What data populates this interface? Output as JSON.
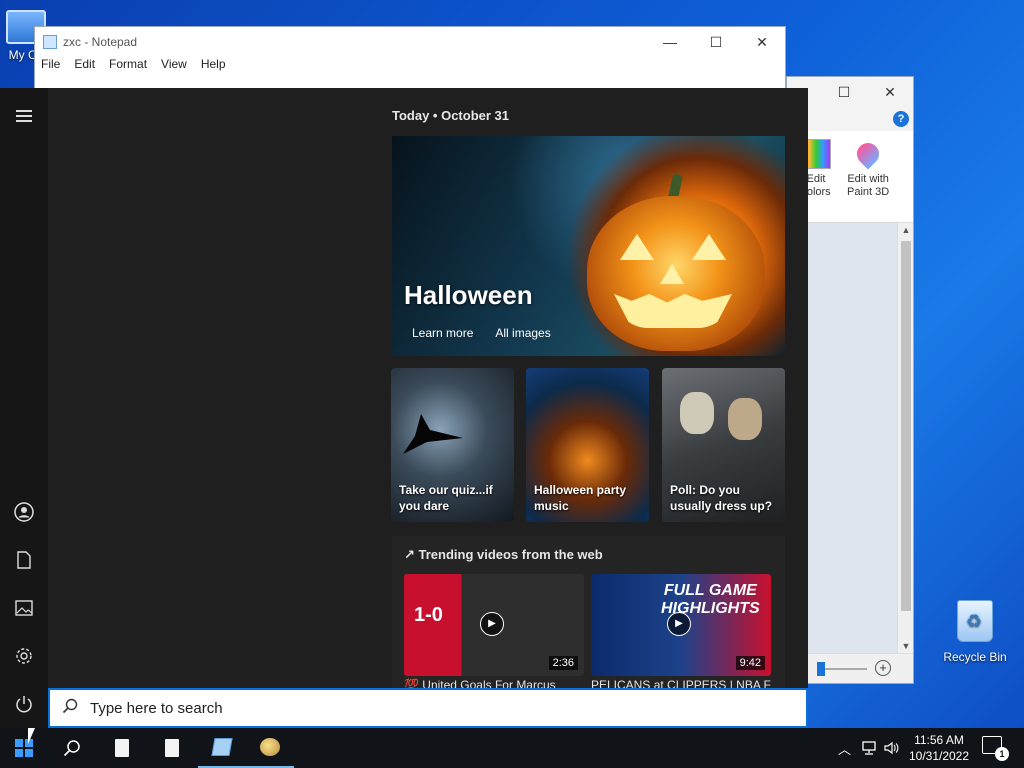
{
  "desktop": {
    "mycomputer_label": "My Co",
    "recycle_label": "Recycle Bin"
  },
  "notepad": {
    "title": "zxc - Notepad",
    "menu": [
      "File",
      "Edit",
      "Format",
      "View",
      "Help"
    ],
    "controls": [
      "—",
      "☐",
      "✕"
    ]
  },
  "paint": {
    "controls": [
      "☐",
      "✕"
    ],
    "help": "?",
    "edit_colors": "Edit\ncolors",
    "edit_paint3d": "Edit with\nPaint 3D"
  },
  "start": {
    "rail_icons": [
      "menu-icon",
      "user-icon",
      "document-icon",
      "pictures-icon",
      "settings-icon",
      "power-icon"
    ],
    "today": "Today  •  October 31",
    "hero": {
      "title": "Halloween",
      "learn_more": "Learn more",
      "all_images": "All images"
    },
    "cards": [
      "Take our quiz...if you dare",
      "Halloween party music",
      "Poll: Do you usually dress up?"
    ],
    "trending_title": "↗ Trending videos from the web",
    "videos": [
      {
        "title": "💯 United Goals For Marcus",
        "duration": "2:36",
        "score": "1-0"
      },
      {
        "title": "PELICANS at CLIPPERS | NBA FULL",
        "duration": "9:42",
        "headline": "FULL GAME\nHIGHLIGHTS"
      }
    ],
    "search_placeholder": "Type here to search"
  },
  "taskbar": {
    "time": "11:56 AM",
    "date": "10/31/2022",
    "notification_count": "1",
    "tray_icons": [
      "chevron-up-icon",
      "network-icon",
      "volume-icon"
    ]
  }
}
